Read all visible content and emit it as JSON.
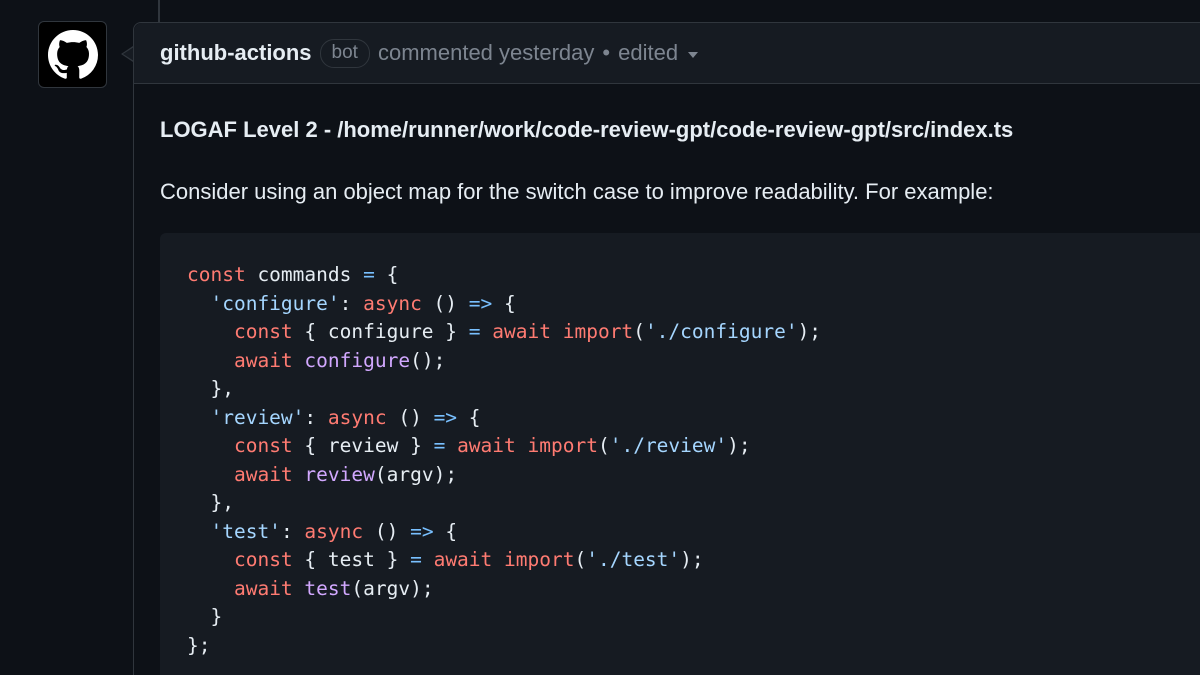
{
  "comment": {
    "author": "github-actions",
    "badge": "bot",
    "meta": "commented yesterday",
    "separator": "•",
    "edited": "edited",
    "heading": "LOGAF Level 2 - /home/runner/work/code-review-gpt/code-review-gpt/src/index.ts",
    "paragraph": "Consider using an object map for the switch case to improve readability. For example:"
  },
  "avatar": {
    "icon": "github-logo-icon"
  },
  "colors": {
    "keyword": "#ff7b72",
    "operator": "#79c0ff",
    "string": "#a5d6ff",
    "function": "#d2a8ff",
    "text": "#e6edf3",
    "muted": "#7d8590",
    "background": "#0d1117"
  },
  "code": {
    "language": "typescript",
    "lines": [
      [
        {
          "t": "const",
          "c": "kw"
        },
        {
          "t": " commands ",
          "c": "pl"
        },
        {
          "t": "=",
          "c": "op"
        },
        {
          "t": " {",
          "c": "pl"
        }
      ],
      [
        {
          "t": "  ",
          "c": "pl"
        },
        {
          "t": "'configure'",
          "c": "str"
        },
        {
          "t": ": ",
          "c": "pl"
        },
        {
          "t": "async",
          "c": "kw"
        },
        {
          "t": " () ",
          "c": "pl"
        },
        {
          "t": "=>",
          "c": "op"
        },
        {
          "t": " {",
          "c": "pl"
        }
      ],
      [
        {
          "t": "    ",
          "c": "pl"
        },
        {
          "t": "const",
          "c": "kw"
        },
        {
          "t": " { configure } ",
          "c": "pl"
        },
        {
          "t": "=",
          "c": "op"
        },
        {
          "t": " ",
          "c": "pl"
        },
        {
          "t": "await",
          "c": "kw"
        },
        {
          "t": " ",
          "c": "pl"
        },
        {
          "t": "import",
          "c": "kw"
        },
        {
          "t": "(",
          "c": "pl"
        },
        {
          "t": "'./configure'",
          "c": "str"
        },
        {
          "t": ");",
          "c": "pl"
        }
      ],
      [
        {
          "t": "    ",
          "c": "pl"
        },
        {
          "t": "await",
          "c": "kw"
        },
        {
          "t": " ",
          "c": "pl"
        },
        {
          "t": "configure",
          "c": "fn"
        },
        {
          "t": "();",
          "c": "pl"
        }
      ],
      [
        {
          "t": "  },",
          "c": "pl"
        }
      ],
      [
        {
          "t": "  ",
          "c": "pl"
        },
        {
          "t": "'review'",
          "c": "str"
        },
        {
          "t": ": ",
          "c": "pl"
        },
        {
          "t": "async",
          "c": "kw"
        },
        {
          "t": " () ",
          "c": "pl"
        },
        {
          "t": "=>",
          "c": "op"
        },
        {
          "t": " {",
          "c": "pl"
        }
      ],
      [
        {
          "t": "    ",
          "c": "pl"
        },
        {
          "t": "const",
          "c": "kw"
        },
        {
          "t": " { review } ",
          "c": "pl"
        },
        {
          "t": "=",
          "c": "op"
        },
        {
          "t": " ",
          "c": "pl"
        },
        {
          "t": "await",
          "c": "kw"
        },
        {
          "t": " ",
          "c": "pl"
        },
        {
          "t": "import",
          "c": "kw"
        },
        {
          "t": "(",
          "c": "pl"
        },
        {
          "t": "'./review'",
          "c": "str"
        },
        {
          "t": ");",
          "c": "pl"
        }
      ],
      [
        {
          "t": "    ",
          "c": "pl"
        },
        {
          "t": "await",
          "c": "kw"
        },
        {
          "t": " ",
          "c": "pl"
        },
        {
          "t": "review",
          "c": "fn"
        },
        {
          "t": "(argv);",
          "c": "pl"
        }
      ],
      [
        {
          "t": "  },",
          "c": "pl"
        }
      ],
      [
        {
          "t": "  ",
          "c": "pl"
        },
        {
          "t": "'test'",
          "c": "str"
        },
        {
          "t": ": ",
          "c": "pl"
        },
        {
          "t": "async",
          "c": "kw"
        },
        {
          "t": " () ",
          "c": "pl"
        },
        {
          "t": "=>",
          "c": "op"
        },
        {
          "t": " {",
          "c": "pl"
        }
      ],
      [
        {
          "t": "    ",
          "c": "pl"
        },
        {
          "t": "const",
          "c": "kw"
        },
        {
          "t": " { test } ",
          "c": "pl"
        },
        {
          "t": "=",
          "c": "op"
        },
        {
          "t": " ",
          "c": "pl"
        },
        {
          "t": "await",
          "c": "kw"
        },
        {
          "t": " ",
          "c": "pl"
        },
        {
          "t": "import",
          "c": "kw"
        },
        {
          "t": "(",
          "c": "pl"
        },
        {
          "t": "'./test'",
          "c": "str"
        },
        {
          "t": ");",
          "c": "pl"
        }
      ],
      [
        {
          "t": "    ",
          "c": "pl"
        },
        {
          "t": "await",
          "c": "kw"
        },
        {
          "t": " ",
          "c": "pl"
        },
        {
          "t": "test",
          "c": "fn"
        },
        {
          "t": "(argv);",
          "c": "pl"
        }
      ],
      [
        {
          "t": "  }",
          "c": "pl"
        }
      ],
      [
        {
          "t": "};",
          "c": "pl"
        }
      ]
    ]
  }
}
